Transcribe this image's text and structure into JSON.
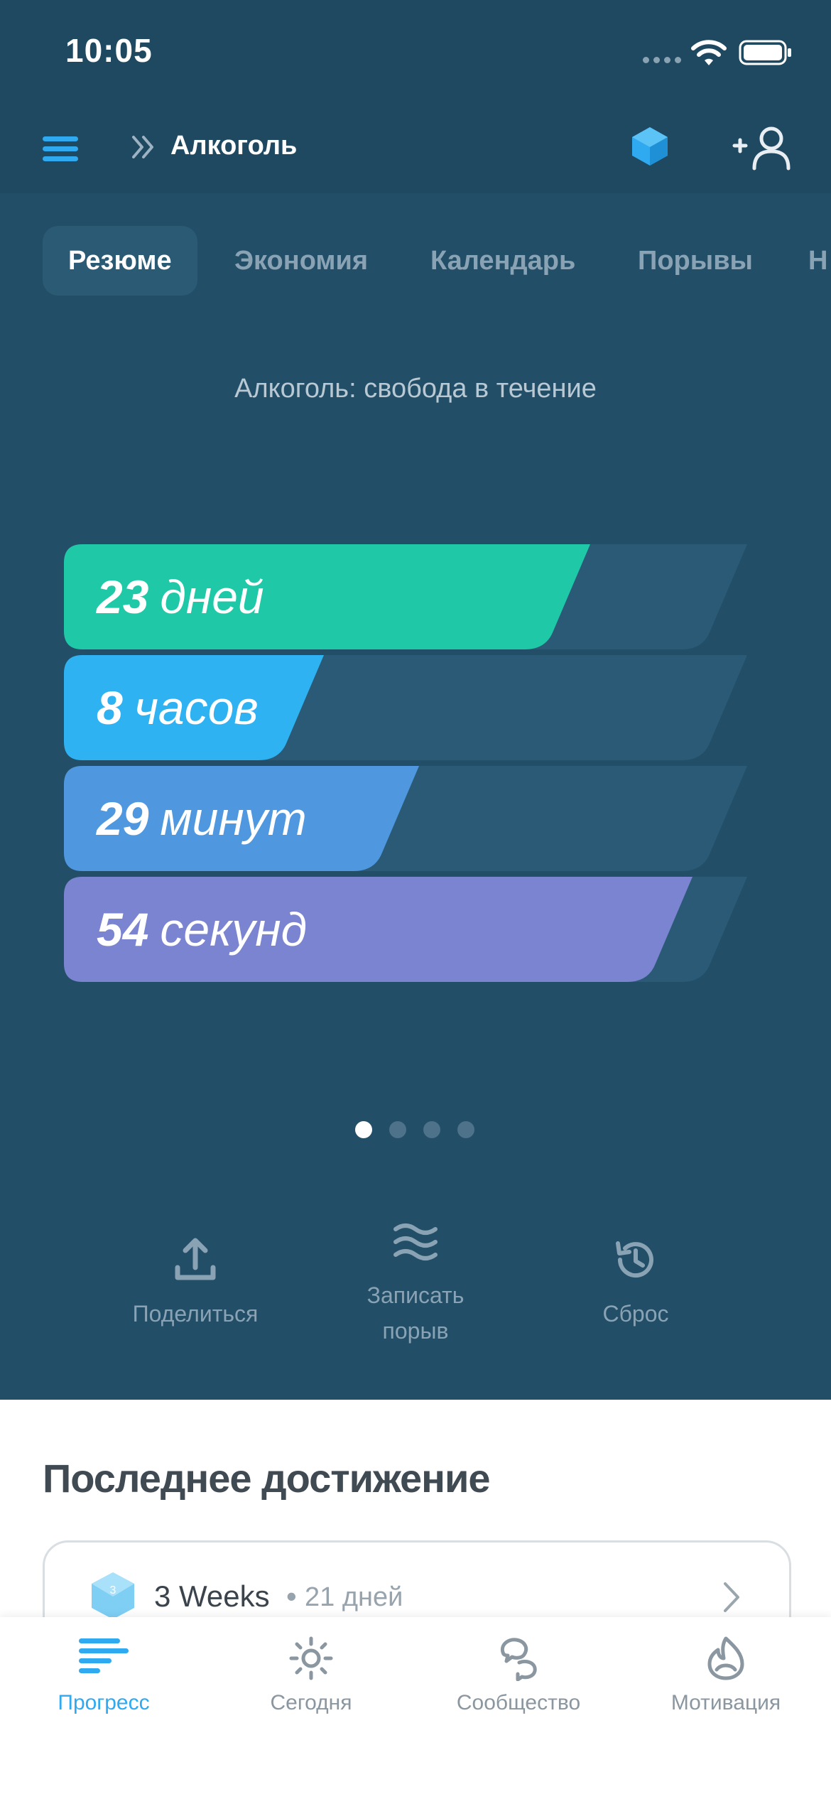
{
  "status_bar": {
    "time": "10:05"
  },
  "nav": {
    "title": "Алкоголь"
  },
  "tabs": [
    "Резюме",
    "Экономия",
    "Календарь",
    "Порывы",
    "Н"
  ],
  "summary": {
    "caption": "Алкоголь: свобода в течение",
    "counters": [
      {
        "value": "23",
        "unit": "дней",
        "fill_fraction": 0.77,
        "color": "#1fc9a8"
      },
      {
        "value": "8",
        "unit": "часов",
        "fill_fraction": 0.38,
        "color": "#2fb2f2"
      },
      {
        "value": "29",
        "unit": "минут",
        "fill_fraction": 0.52,
        "color": "#4f98e0"
      },
      {
        "value": "54",
        "unit": "секунд",
        "fill_fraction": 0.92,
        "color": "#7a84d1"
      }
    ],
    "page_indicator": {
      "count": 4,
      "active": 0
    }
  },
  "actions": {
    "share": "Поделиться",
    "record_line1": "Записать",
    "record_line2": "порыв",
    "reset": "Сброс"
  },
  "achievement": {
    "section_title": "Последнее достижение",
    "badge": "3",
    "title": "3 Weeks",
    "separator": "•",
    "subtitle": "21 дней"
  },
  "tabbar": {
    "progress": "Прогресс",
    "today": "Сегодня",
    "community": "Сообщество",
    "motivation": "Мотивация"
  },
  "colors": {
    "background_top": "#224e68",
    "accent": "#2fa9ef"
  }
}
